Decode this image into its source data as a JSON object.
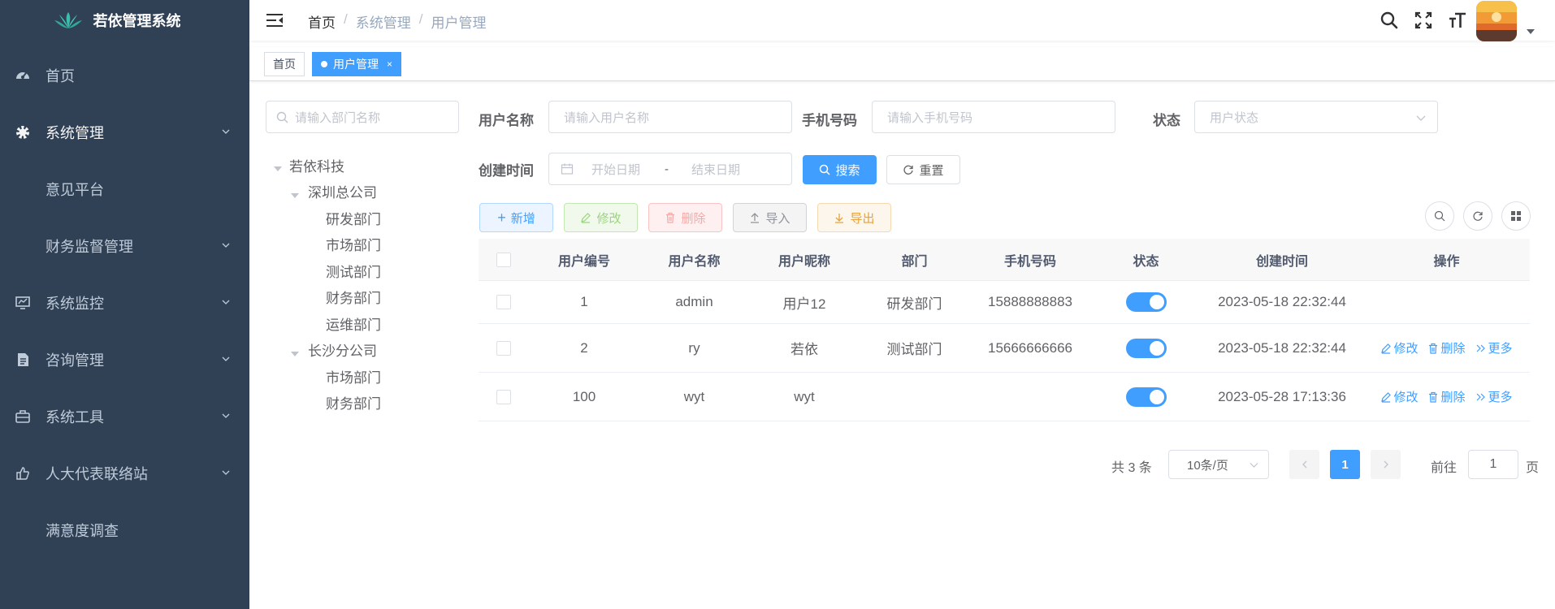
{
  "app": {
    "title": "若依管理系统"
  },
  "sidebar": {
    "items": [
      {
        "label": "首页",
        "icon": "dashboard-icon",
        "expandable": false
      },
      {
        "label": "系统管理",
        "icon": "gear-icon",
        "expandable": true,
        "active": true
      },
      {
        "label": "意见平台",
        "icon": "",
        "expandable": false
      },
      {
        "label": "财务监督管理",
        "icon": "",
        "expandable": true
      },
      {
        "label": "系统监控",
        "icon": "monitor-icon",
        "expandable": true
      },
      {
        "label": "咨询管理",
        "icon": "document-icon",
        "expandable": true
      },
      {
        "label": "系统工具",
        "icon": "toolbox-icon",
        "expandable": true
      },
      {
        "label": "人大代表联络站",
        "icon": "hand-icon",
        "expandable": true
      },
      {
        "label": "满意度调查",
        "icon": "",
        "expandable": false
      }
    ]
  },
  "breadcrumb": [
    "首页",
    "系统管理",
    "用户管理"
  ],
  "breadcrumb_separator": "/",
  "tags": [
    {
      "label": "首页",
      "active": false
    },
    {
      "label": "用户管理",
      "active": true,
      "close": "×"
    }
  ],
  "dept_tree": {
    "search_placeholder": "请输入部门名称",
    "nodes": [
      {
        "label": "若依科技",
        "level": 0,
        "expanded": true
      },
      {
        "label": "深圳总公司",
        "level": 1,
        "expanded": true
      },
      {
        "label": "研发部门",
        "level": 2
      },
      {
        "label": "市场部门",
        "level": 2
      },
      {
        "label": "测试部门",
        "level": 2
      },
      {
        "label": "财务部门",
        "level": 2
      },
      {
        "label": "运维部门",
        "level": 2
      },
      {
        "label": "长沙分公司",
        "level": 1,
        "expanded": true
      },
      {
        "label": "市场部门",
        "level": 2
      },
      {
        "label": "财务部门",
        "level": 2
      }
    ]
  },
  "filters": {
    "username_label": "用户名称",
    "username_placeholder": "请输入用户名称",
    "phone_label": "手机号码",
    "phone_placeholder": "请输入手机号码",
    "status_label": "状态",
    "status_placeholder": "用户状态",
    "created_label": "创建时间",
    "start_placeholder": "开始日期",
    "range_separator": "-",
    "end_placeholder": "结束日期",
    "search_button": "搜索",
    "reset_button": "重置"
  },
  "toolbar": {
    "add": "新增",
    "edit": "修改",
    "delete": "删除",
    "import": "导入",
    "export": "导出"
  },
  "table": {
    "columns": [
      "用户编号",
      "用户名称",
      "用户昵称",
      "部门",
      "手机号码",
      "状态",
      "创建时间",
      "操作"
    ],
    "rows": [
      {
        "id": "1",
        "username": "admin",
        "nickname": "用户12",
        "dept": "研发部门",
        "phone": "15888888883",
        "status": true,
        "created": "2023-05-18 22:32:44",
        "actions": []
      },
      {
        "id": "2",
        "username": "ry",
        "nickname": "若依",
        "dept": "测试部门",
        "phone": "15666666666",
        "status": true,
        "created": "2023-05-18 22:32:44",
        "actions": [
          "修改",
          "删除",
          "更多"
        ]
      },
      {
        "id": "100",
        "username": "wyt",
        "nickname": "wyt",
        "dept": "",
        "phone": "",
        "status": true,
        "created": "2023-05-28 17:13:36",
        "actions": [
          "修改",
          "删除",
          "更多"
        ]
      }
    ]
  },
  "pagination": {
    "total": "共 3 条",
    "page_size": "10条/页",
    "current_page": "1",
    "goto_label": "前往",
    "goto_value": "1",
    "page_suffix": "页"
  },
  "colors": {
    "sidebar_bg": "#304156",
    "primary": "#409eff"
  }
}
